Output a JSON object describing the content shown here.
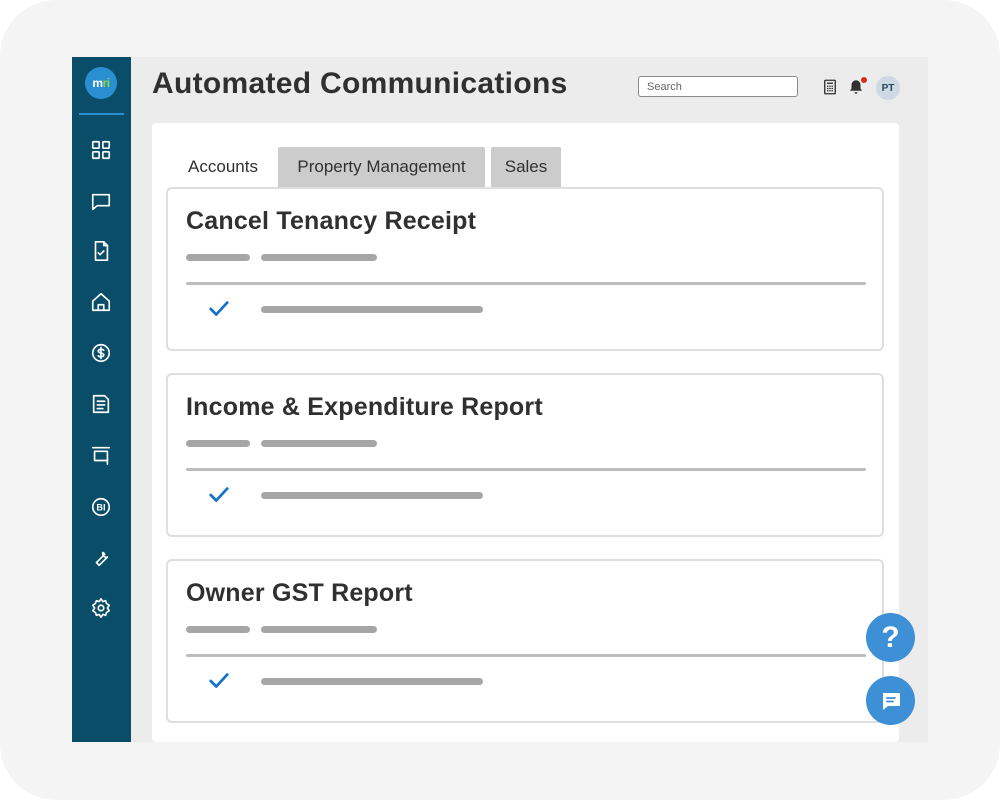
{
  "app": {
    "title": "Automated Communications",
    "logo": {
      "text_main": "m",
      "text_accent": "ri"
    }
  },
  "sidebar": {
    "items": [
      {
        "icon": "dashboard-icon"
      },
      {
        "icon": "chat-icon"
      },
      {
        "icon": "document-check-icon"
      },
      {
        "icon": "house-icon"
      },
      {
        "icon": "dollar-icon"
      },
      {
        "icon": "article-icon"
      },
      {
        "icon": "presentation-icon"
      },
      {
        "icon": "bi-icon",
        "label": "BI"
      },
      {
        "icon": "wrench-icon"
      },
      {
        "icon": "settings-icon"
      }
    ]
  },
  "header": {
    "search_placeholder": "Search",
    "avatar_initials": "PT",
    "icons": [
      "calculator-icon",
      "bell-icon"
    ]
  },
  "tabs": [
    {
      "label": "Accounts",
      "active": true
    },
    {
      "label": "Property Management",
      "active": false
    },
    {
      "label": "Sales",
      "active": false
    }
  ],
  "cards": [
    {
      "title": "Cancel Tenancy Receipt"
    },
    {
      "title": "Income & Expenditure Report"
    },
    {
      "title": "Owner GST Report"
    }
  ],
  "fabs": {
    "help_label": "?"
  },
  "colors": {
    "sidebar": "#0a4d69",
    "accent": "#2a8fd1",
    "check": "#1473c8",
    "fab": "#3d8fd6",
    "notification": "#d62a1e"
  }
}
